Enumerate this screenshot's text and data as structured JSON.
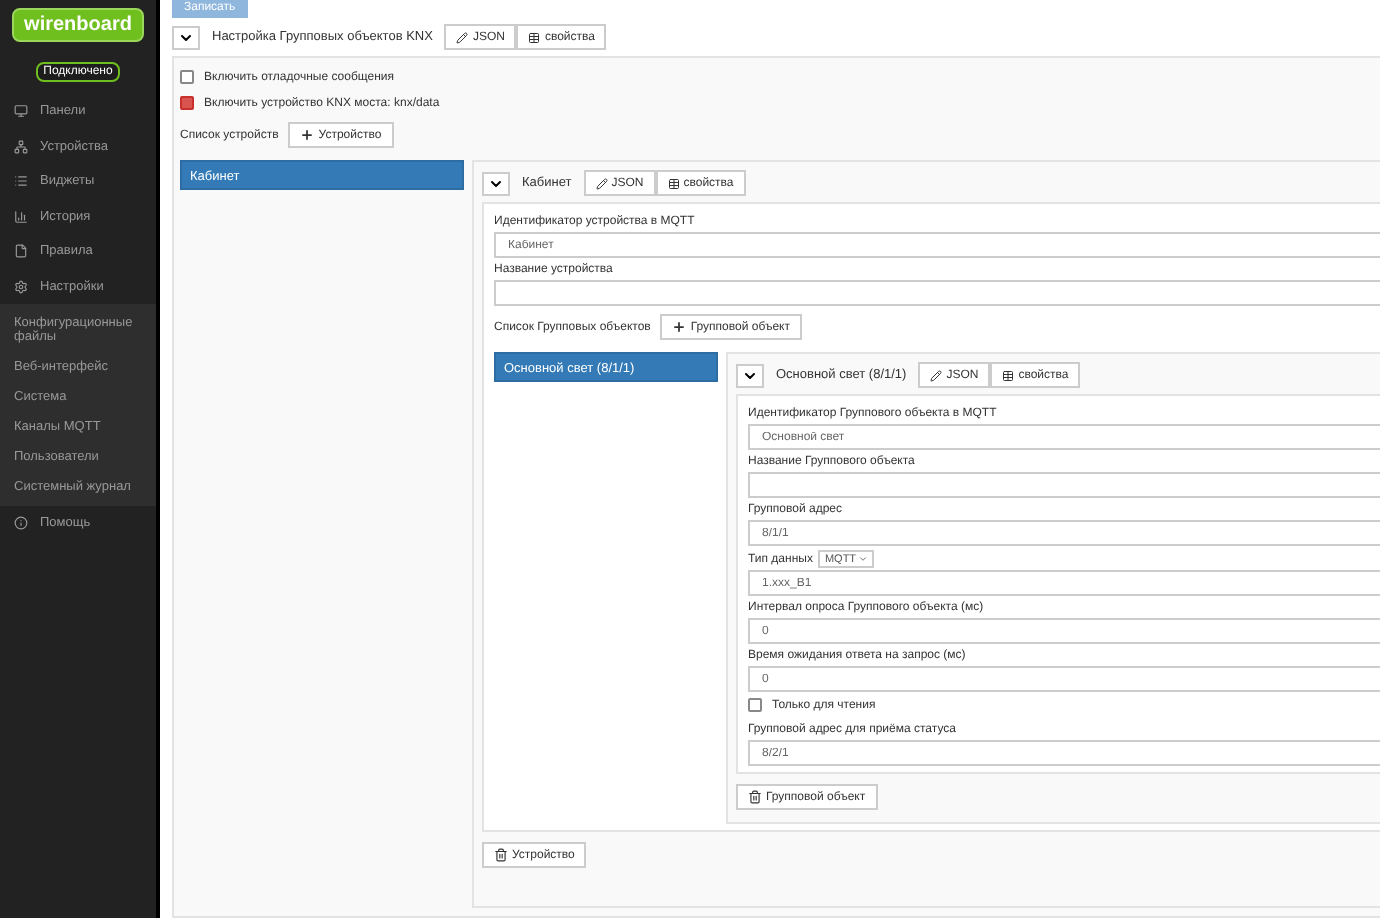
{
  "sidebar": {
    "logo": "wirenboard",
    "status": "Подключено",
    "items": [
      {
        "label": "Панели"
      },
      {
        "label": "Устройства"
      },
      {
        "label": "Виджеты"
      },
      {
        "label": "История"
      },
      {
        "label": "Правила"
      },
      {
        "label": "Настройки",
        "expanded": true,
        "children": [
          {
            "label": "Конфигурационные файлы"
          },
          {
            "label": "Веб-интерфейс"
          },
          {
            "label": "Система"
          },
          {
            "label": "Каналы MQTT"
          },
          {
            "label": "Пользователи"
          },
          {
            "label": "Системный журнал"
          }
        ]
      },
      {
        "label": "Помощь"
      }
    ]
  },
  "save_button": "Записать",
  "root": {
    "title": "Настройка Групповых объектов KNX",
    "json_button": "JSON",
    "props_button": "свойства",
    "options": [
      {
        "label": "Включить отладочные сообщения",
        "checked": false
      },
      {
        "label": "Включить устройство KNX моста: knx/data",
        "checked": true
      }
    ],
    "devices_label": "Список устройств",
    "add_device_button": "Устройство",
    "devices": [
      {
        "label": "Кабинет",
        "selected": true
      }
    ],
    "device": {
      "title": "Кабинет",
      "json_button": "JSON",
      "props_button": "свойства",
      "fields": [
        {
          "label": "Идентификатор устройства в MQTT",
          "value": "Кабинет"
        },
        {
          "label": "Название устройства"
        }
      ],
      "objects_label": "Список Групповых объектов",
      "add_object_button": "Групповой объект",
      "objects": [
        {
          "label": "Основной свет (8/1/1)",
          "selected": true
        }
      ],
      "object": {
        "title": "Основной свет (8/1/1)",
        "json_button": "JSON",
        "props_button": "свойства",
        "fields": [
          {
            "kind": "text",
            "label": "Идентификатор Группового объекта в MQTT",
            "value": "Основной свет"
          },
          {
            "kind": "text",
            "label": "Название Группового объекта"
          },
          {
            "kind": "text",
            "label": "Групповой адрес",
            "value": "8/1/1"
          },
          {
            "kind": "typed",
            "label": "Тип данных",
            "type": "MQTT",
            "value": "1.xxx_B1"
          },
          {
            "kind": "text",
            "label": "Интервал опроса Группового объекта (мс)",
            "value": "0"
          },
          {
            "kind": "text",
            "label": "Время ожидания ответа на запрос (мс)",
            "value": "0"
          },
          {
            "kind": "checkbox",
            "label": "Только для чтения",
            "checked": false
          },
          {
            "kind": "text",
            "label": "Групповой адрес для приёма статуса",
            "value": "8/2/1"
          }
        ],
        "delete_button": "Групповой объект"
      },
      "delete_button": "Устройство"
    }
  }
}
